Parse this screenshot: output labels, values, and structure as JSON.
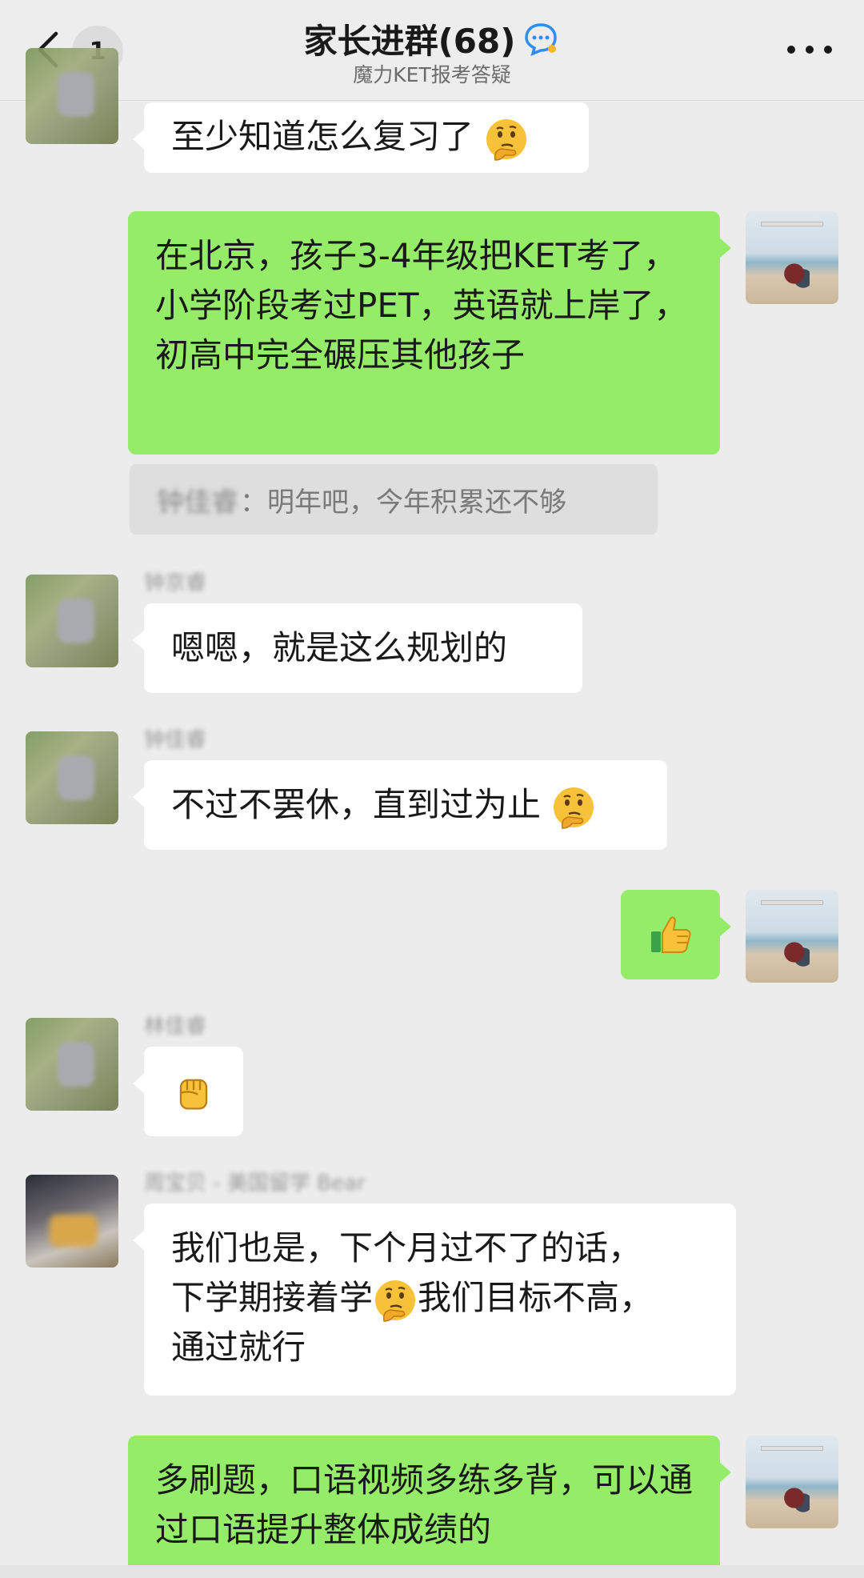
{
  "header": {
    "back_label": "back",
    "unread_count": "1",
    "title": "家长进群(68)",
    "subtitle": "魔力KET报考答疑",
    "more_label": "more"
  },
  "quote": {
    "name": "钟佳睿",
    "text": "：明年吧，今年积累还不够"
  },
  "messages": [
    {
      "direction": "in",
      "text": "至少知道怎么复习了"
    },
    {
      "direction": "out",
      "text": "在北京，孩子3-4年级把KET考了，小学阶段考过PET，英语就上岸了，初高中完全碾压其他孩子"
    },
    {
      "direction": "in",
      "sender": "钟京睿",
      "text": "嗯嗯，就是这么规划的"
    },
    {
      "direction": "in",
      "sender": "钟佳睿",
      "text": "不过不罢休，直到过为止"
    },
    {
      "direction": "out",
      "text": "thumbs-up"
    },
    {
      "direction": "in",
      "sender": "林佳睿",
      "text": "fist"
    },
    {
      "direction": "in",
      "sender": "周宝贝 - 美国留学 Bear",
      "text_line1": "我们也是，下个月过不了的话，",
      "text_line2a": "下学期接着学",
      "text_line2b": "我们目标不高，",
      "text_line3": "通过就行"
    },
    {
      "direction": "out",
      "text": "多刷题，口语视频多练多背，可以通过口语提升整体成绩的"
    }
  ],
  "colors": {
    "background": "#ececec",
    "incoming_bubble": "#ffffff",
    "outgoing_bubble": "#95ec69",
    "text": "#191919"
  },
  "icons": [
    "back-chevron-icon",
    "chat-bubble-icon",
    "more-dots-icon",
    "thinking-face-icon",
    "thumbs-up-icon",
    "raised-fist-icon"
  ]
}
